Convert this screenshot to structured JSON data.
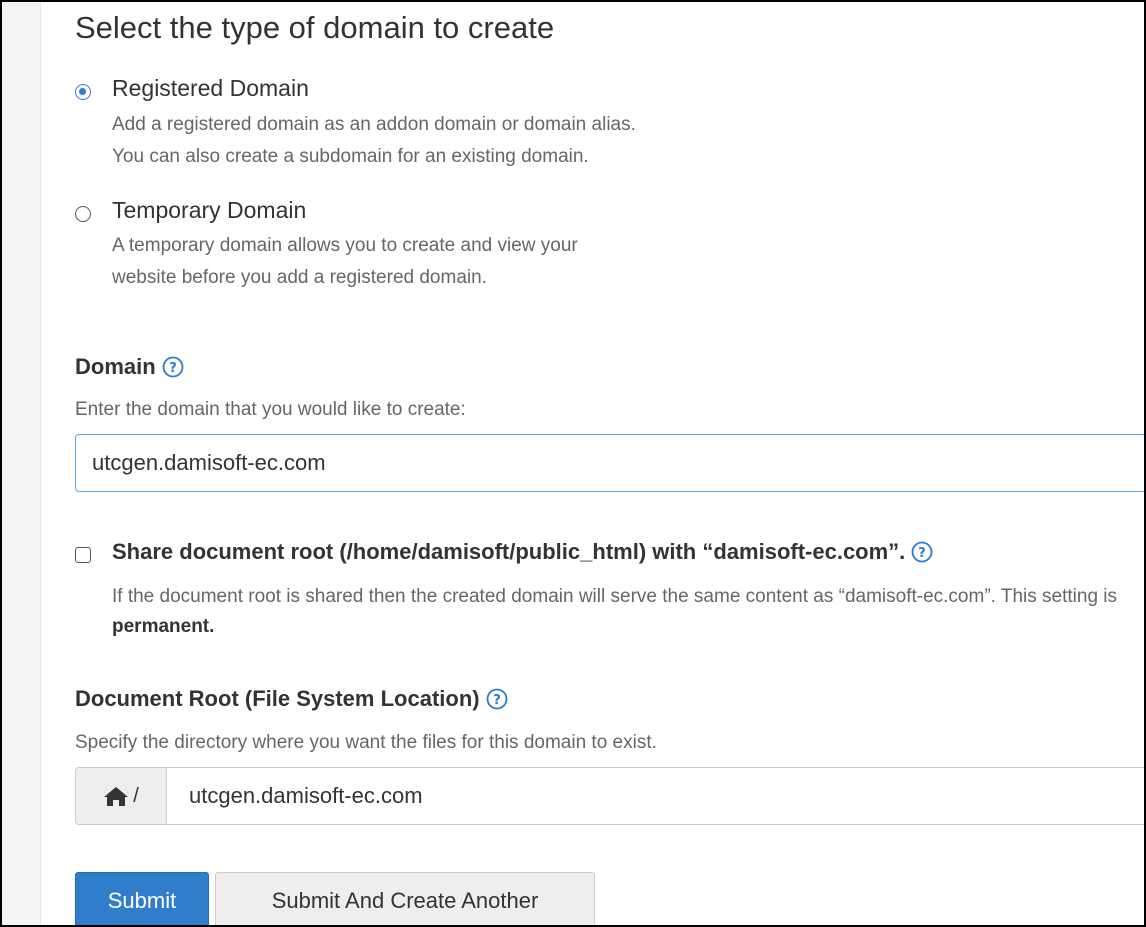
{
  "page": {
    "title": "Select the type of domain to create"
  },
  "domain_type": {
    "selected": "registered",
    "options": [
      {
        "id": "registered",
        "label": "Registered Domain",
        "description_lines": [
          "Add a registered domain as an addon domain or domain alias.",
          "You can also create a subdomain for an existing domain."
        ]
      },
      {
        "id": "temporary",
        "label": "Temporary Domain",
        "description_lines": [
          "A temporary domain allows you to create and view your",
          "website before you add a registered domain."
        ]
      }
    ]
  },
  "domain_field": {
    "label": "Domain",
    "help": "Enter the domain that you would like to create:",
    "value": "utcgen.damisoft-ec.com"
  },
  "share_root": {
    "checked": false,
    "label": "Share document root (/home/damisoft/public_html) with “damisoft-ec.com”.",
    "description": "If the document root is shared then the created domain will serve the same content as “damisoft-ec.com”. This setting is",
    "description_bold": "permanent."
  },
  "document_root": {
    "label": "Document Root (File System Location)",
    "help": "Specify the directory where you want the files for this domain to exist.",
    "prefix_icon": "home-icon",
    "prefix_text": "/",
    "value": "utcgen.damisoft-ec.com"
  },
  "actions": {
    "submit_label": "Submit",
    "submit_another_label": "Submit And Create Another"
  },
  "colors": {
    "accent": "#2a7bd4",
    "primary_button": "#2f7dcb",
    "input_focus_border": "#66a6e0"
  }
}
